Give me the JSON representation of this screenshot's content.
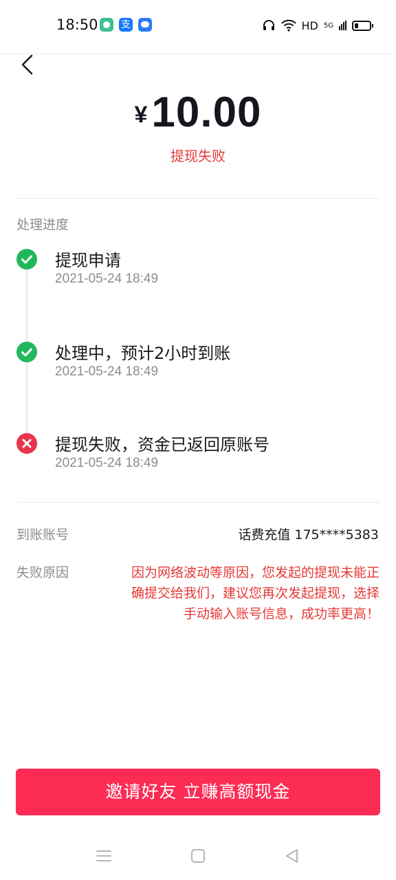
{
  "status_bar": {
    "time": "18:50",
    "network_type": "HD",
    "cellular_label": "5G",
    "app_icons": [
      "app-notification-icon",
      "alipay-icon",
      "message-icon"
    ],
    "right_icons": [
      "headset-icon",
      "wifi-icon",
      "signal-icon",
      "battery-icon"
    ]
  },
  "amount": {
    "currency": "¥",
    "value": "10.00"
  },
  "status_text": "提现失败",
  "progress": {
    "label": "处理进度",
    "steps": [
      {
        "title": "提现申请",
        "time": "2021-05-24 18:49",
        "state": "success",
        "icon": "check-circle-icon"
      },
      {
        "title": "处理中，预计2小时到账",
        "time": "2021-05-24 18:49",
        "state": "success",
        "icon": "check-circle-icon"
      },
      {
        "title": "提现失败，资金已返回原账号",
        "time": "2021-05-24 18:49",
        "state": "failed",
        "icon": "x-circle-icon"
      }
    ]
  },
  "account": {
    "label": "到账账号",
    "value": "话费充值 175****5383"
  },
  "reason": {
    "label": "失败原因",
    "value": "因为网络波动等原因，您发起的提现未能正确提交给我们，建议您再次发起提现，选择手动输入账号信息，成功率更高！"
  },
  "invite_button": "邀请好友 立赚高额现金",
  "colors": {
    "accent": "#fd2c55",
    "error": "#e53935",
    "success": "#21b85c",
    "fail_icon": "#e8354b",
    "muted": "#8c8c8c"
  },
  "system_nav": [
    "menu-icon",
    "home-icon",
    "back-triangle-icon"
  ]
}
